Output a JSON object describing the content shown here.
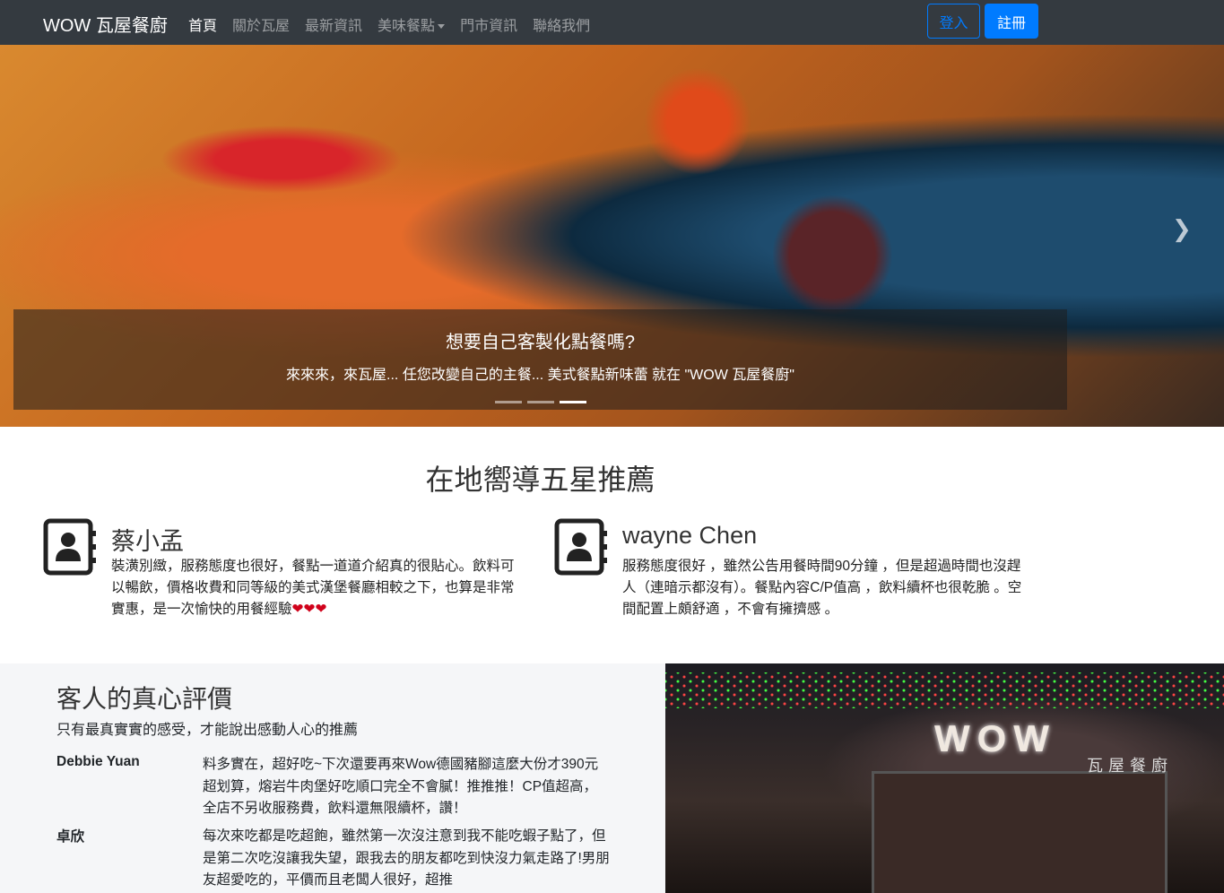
{
  "nav": {
    "brand": "WOW 瓦屋餐廚",
    "links": [
      "首頁",
      "關於瓦屋",
      "最新資訊",
      "美味餐點",
      "門市資訊",
      "聯絡我們"
    ],
    "login": "登入",
    "register": "註冊"
  },
  "carousel": {
    "title": "想要自己客製化點餐嗎?",
    "text": "來來來，來瓦屋... 任您改變自己的主餐... 美式餐點新味蕾 就在 \"WOW 瓦屋餐廚\"",
    "slides": 3,
    "active_slide": 3,
    "next_icon": "chevron-right-icon"
  },
  "featured": {
    "heading": "在地嚮導五星推薦",
    "reviews": [
      {
        "name": "蔡小孟",
        "text": "裝潢別緻，服務態度也很好，餐點一道道介紹真的很貼心。飲料可以暢飲，價格收費和同等級的美式漢堡餐廳相較之下，也算是非常實惠，是一次愉快的用餐經驗",
        "hearts": "❤❤❤"
      },
      {
        "name": "wayne Chen",
        "text": "服務態度很好 ，雖然公告用餐時間90分鐘 ，但是超過時間也沒趕人（連暗示都沒有）。餐點內容C/P值高 ，飲料續杯也很乾脆 。空間配置上頗舒適 ，不會有擁擠感 。"
      }
    ]
  },
  "testimonials": {
    "heading": "客人的真心評價",
    "subtitle": "只有最真實實的感受，才能說出感動人心的推薦",
    "items": [
      {
        "name": "Debbie Yuan",
        "text": "料多實在，超好吃~下次還要再來Wow德國豬腳這麼大份才390元超划算，熔岩牛肉堡好吃順口完全不會膩！推推推！CP值超高，全店不另收服務費，飲料還無限續杯，讚！"
      },
      {
        "name": "卓欣",
        "text": "每次來吃都是吃超飽，雖然第一次沒注意到我不能吃蝦子點了，但是第二次吃沒讓我失望，跟我去的朋友都吃到快沒力氣走路了!男朋友超愛吃的，平價而且老闆人很好，超推"
      }
    ]
  },
  "storefront": {
    "sign": "WOW",
    "sign_sub": "瓦屋餐廚"
  },
  "colors": {
    "navbar": "#343a40",
    "primary": "#007bff"
  }
}
